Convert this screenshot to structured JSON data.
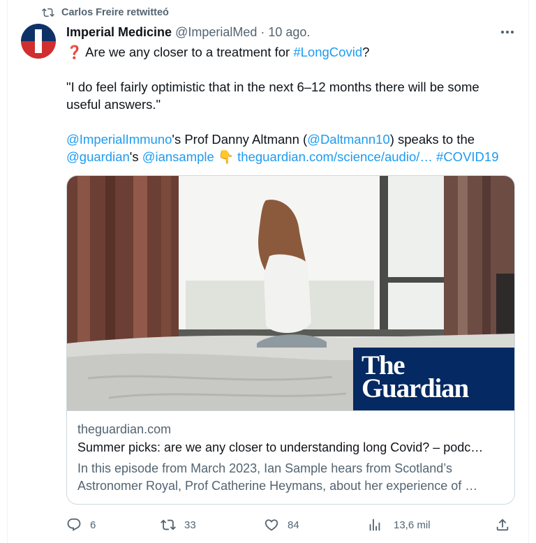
{
  "retweet": {
    "text": "Carlos Freire retwitteó",
    "icon": "retweet-icon"
  },
  "author": {
    "name": "Imperial Medicine",
    "handle": "@ImperialMed",
    "separator": "·",
    "time": "10 ago."
  },
  "tweet": {
    "line1_emoji": "❓",
    "line1_text": "Are we any closer to a treatment for ",
    "line1_hashtag": "#LongCovid",
    "line1_end": "?",
    "quote_line1": "\"I do feel fairly optimistic that in the next 6–12 months there will be some",
    "quote_line2": "useful answers.\"",
    "mention1": "@ImperialImmuno",
    "text_a": "'s Prof Danny Altmann (",
    "mention2": "@Daltmann10",
    "text_b": ") speaks to the",
    "mention3": "@guardian",
    "text_c": "'s ",
    "mention4": "@iansample",
    "emoji_point": "👇",
    "url": "theguardian.com/science/audio/…",
    "hashtag2": "#COVID19"
  },
  "card": {
    "logo_line1": "The",
    "logo_line2": "Guardian",
    "domain": "theguardian.com",
    "title": "Summer picks: are we any closer to understanding long Covid? – podc…",
    "desc_line1": "In this episode from March 2023, Ian Sample hears from Scotland’s",
    "desc_line2": "Astronomer Royal, Prof Catherine Heymans, about her experience of …"
  },
  "actions": {
    "replies": "6",
    "retweets": "33",
    "likes": "84",
    "views": "13,6 mil"
  },
  "colors": {
    "link": "#1d9bf0",
    "muted": "#536471",
    "text": "#0f1419",
    "guardian_blue": "#052962"
  }
}
